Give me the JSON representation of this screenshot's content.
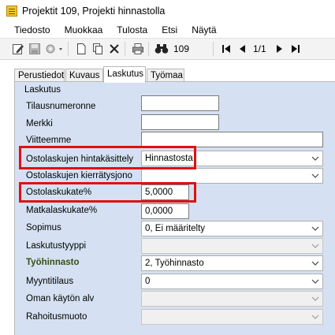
{
  "window": {
    "title": "Projektit 109, Projekti hinnastolla"
  },
  "menu": [
    "Tiedosto",
    "Muokkaa",
    "Tulosta",
    "Etsi",
    "Näytä"
  ],
  "toolbar": {
    "search_value": "109",
    "page_indicator": "1/1"
  },
  "tabs": [
    "Perustiedot",
    "Kuvaus",
    "Laskutus",
    "Työmaa"
  ],
  "active_tab": "Laskutus",
  "section_title": "Laskutus",
  "fields": {
    "tilausnumeronne": {
      "label": "Tilausnumeronne",
      "value": ""
    },
    "merkki": {
      "label": "Merkki",
      "value": ""
    },
    "viitteemme": {
      "label": "Viitteemme",
      "value": ""
    },
    "ostolaskujen_hintakasittely": {
      "label": "Ostolaskujen hintakäsittely",
      "value": "Hinnastosta"
    },
    "ostolaskujen_kierratysjono": {
      "label": "Ostolaskujen kierrätysjono",
      "value": ""
    },
    "ostolaskukate": {
      "label": "Ostolaskukate%",
      "value": "5,0000"
    },
    "matkalaskukate": {
      "label": "Matkalaskukate%",
      "value": "0,0000"
    },
    "sopimus": {
      "label": "Sopimus",
      "value": "0, Ei määritelty"
    },
    "laskutustyyppi": {
      "label": "Laskutustyyppi",
      "value": ""
    },
    "tyohinnasto": {
      "label": "Työhinnasto",
      "value": "2, Työhinnasto"
    },
    "myyntitilaus": {
      "label": "Myyntitilaus",
      "value": "0"
    },
    "oman_kayton_alv": {
      "label": "Oman käytön alv",
      "value": ""
    },
    "rahoitusmuoto": {
      "label": "Rahoitusmuoto",
      "value": ""
    }
  },
  "colors": {
    "panel_bg": "#d5e1f2",
    "highlight": "#e01010",
    "bold_label": "#3d4c14"
  }
}
